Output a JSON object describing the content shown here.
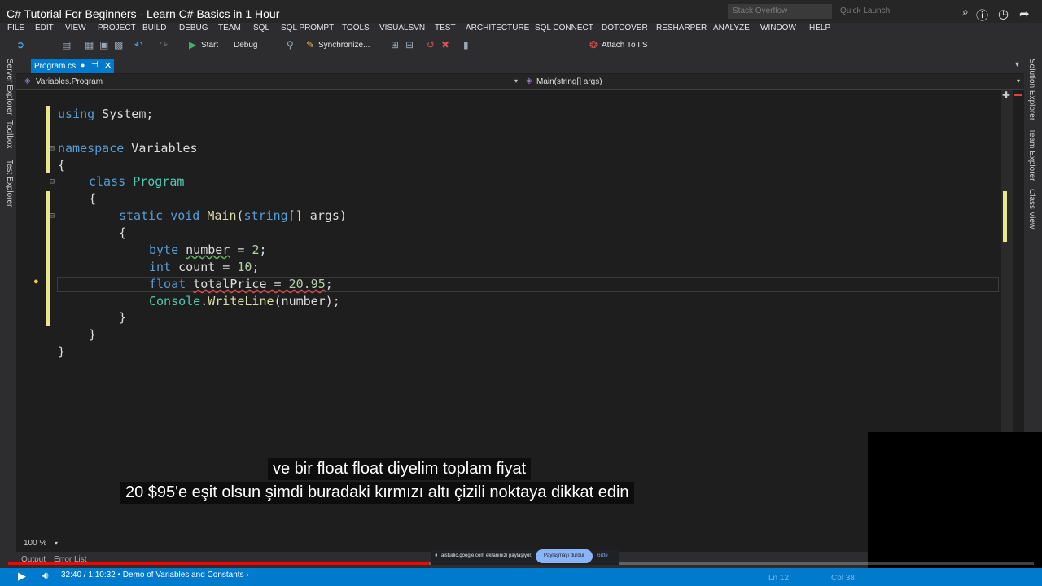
{
  "video": {
    "title": "C# Tutorial For Beginners - Learn C# Basics in 1 Hour",
    "time": "32:40 / 1:10:32",
    "chapter": "• Demo of Variables and Constants ›",
    "progress_fraction": 0.41,
    "subtitle_line1": "ve bir float float diyelim toplam fiyat",
    "subtitle_line2": "20 $95'e eşit olsun şimdi buradaki kırmızı altı çizili noktaya dikkat edin"
  },
  "header": {
    "search_placeholder": "Stack Overflow",
    "quick_launch": "Quick Launch"
  },
  "menu": [
    "FILE",
    "EDIT",
    "VIEW",
    "PROJECT",
    "BUILD",
    "DEBUG",
    "TEAM",
    "SQL",
    "SQL PROMPT",
    "TOOLS",
    "VISUALSVN",
    "TEST",
    "ARCHITECTURE",
    "SQL CONNECT",
    "DOTCOVER",
    "RESHARPER",
    "ANALYZE",
    "WINDOW",
    "HELP"
  ],
  "toolbar": {
    "start": "Start",
    "config": "Debug",
    "sync": "Synchronize...",
    "attach": "Attach To IIS"
  },
  "left_panels": [
    "Server Explorer",
    "Toolbox",
    "Test Explorer"
  ],
  "right_panels": [
    "Solution Explorer",
    "Team Explorer",
    "Class View"
  ],
  "tab": {
    "label": "Program.cs"
  },
  "nav": {
    "left": "Variables.Program",
    "right": "Main(string[] args)"
  },
  "code": {
    "l1_kw": "using",
    "l1_rest": " System;",
    "l2_kw": "namespace",
    "l2_rest": " Variables",
    "open_brace": "{",
    "l4_kw": "class",
    "l4_type": "Program",
    "l6_kw1": "static",
    "l6_kw2": "void",
    "l6_fn": "Main",
    "l6_p1": "(",
    "l6_kw3": "string",
    "l6_p2": "[] args)",
    "l8_kw": "byte",
    "l8_var": "number",
    "l8_eq": " = ",
    "l8_num": "2",
    "semi": ";",
    "l9_kw": "int",
    "l9_var": " count = ",
    "l9_num": "10",
    "l10_kw": "float",
    "l10_var": "totalPrice",
    "l10_eq": " = ",
    "l10_num": "20.95",
    "l11_type": "Console",
    "dot": ".",
    "l11_fn": "WriteLine",
    "l11_rest": "(number);",
    "close_brace": "}"
  },
  "bottom": {
    "zoom": "100 %",
    "output": "Output",
    "error_list": "Error List",
    "share_text": "aistudio.google.com ekranınızı paylaşıyor.",
    "share_stop": "Paylaşmayı durdur",
    "share_hide": "Gizle",
    "ln": "Ln 12",
    "col": "Col 38"
  }
}
